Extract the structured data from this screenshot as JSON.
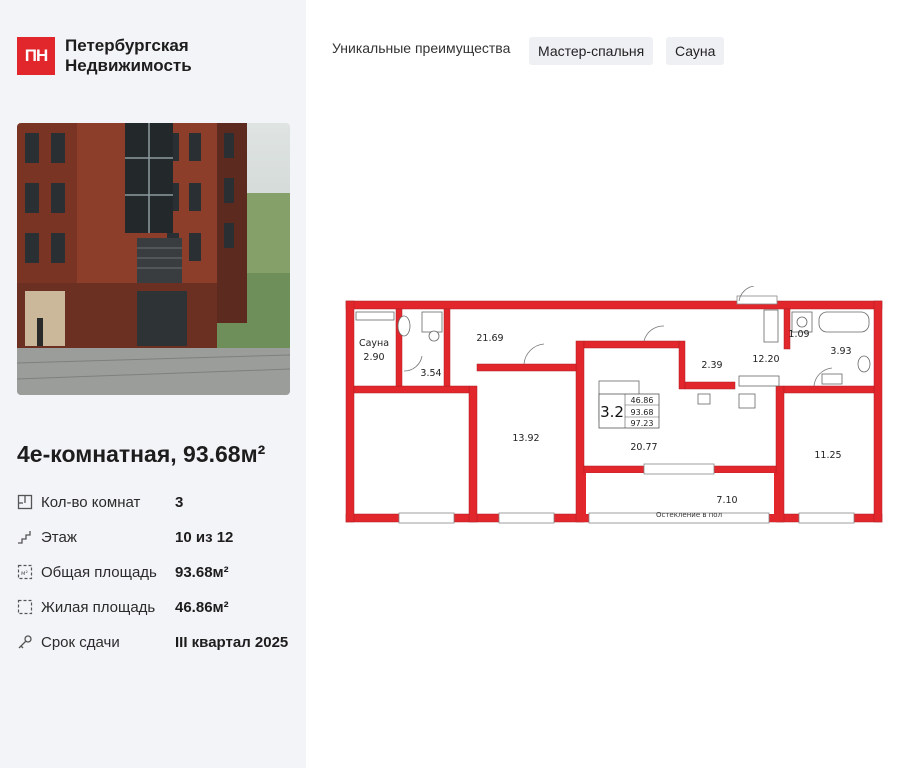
{
  "brand": {
    "mark": "ПН",
    "name_line1": "Петербургская",
    "name_line2": "Недвижимость"
  },
  "listing": {
    "title": "4е-комнатная, 93.68м²",
    "specs": [
      {
        "icon": "plan-icon",
        "label": "Кол-во комнат",
        "value": "3"
      },
      {
        "icon": "stairs-icon",
        "label": "Этаж",
        "value": "10 из 12"
      },
      {
        "icon": "area-icon",
        "label": "Общая площадь",
        "value": "93.68м²"
      },
      {
        "icon": "living-area-icon",
        "label": "Жилая площадь",
        "value": "46.86м²"
      },
      {
        "icon": "key-icon",
        "label": "Срок сдачи",
        "value": "III квартал 2025"
      }
    ]
  },
  "features": {
    "label": "Уникальные преимущества",
    "chips": [
      "Мастер-спальня",
      "Сауна"
    ]
  },
  "plan": {
    "rooms": {
      "sauna_label": "Сауна",
      "sauna": "2.90",
      "bath_small": "3.54",
      "room_top": "21.69",
      "room_left": "13.92",
      "kitchen": "20.77",
      "closet": "2.39",
      "hall": "12.20",
      "wc": "1.09",
      "bathroom": "3.93",
      "room_right": "11.25",
      "balcony": "7.10"
    },
    "info": {
      "code": "3.2",
      "living": "46.86",
      "total": "93.68",
      "total_with_balcony": "97.23"
    },
    "glazing_note": "Остекление в пол"
  },
  "colors": {
    "accent": "#e1262c",
    "sidebar_bg": "#f3f4f8",
    "chip_bg": "#eff0f4"
  }
}
